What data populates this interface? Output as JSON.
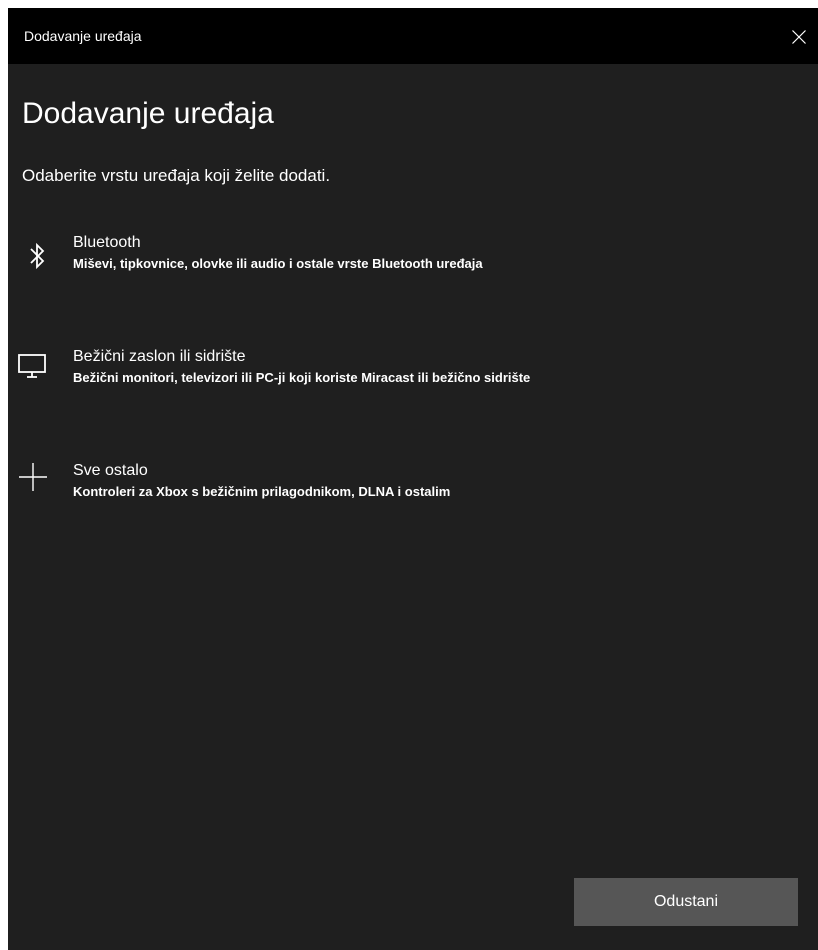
{
  "window": {
    "title": "Dodavanje uređaja"
  },
  "main": {
    "heading": "Dodavanje uređaja",
    "subtitle": "Odaberite vrstu uređaja koji želite dodati.",
    "options": [
      {
        "icon": "bluetooth-icon",
        "title": "Bluetooth",
        "description": "Miševi, tipkovnice, olovke ili audio i ostale vrste Bluetooth uređaja"
      },
      {
        "icon": "monitor-icon",
        "title": "Bežični zaslon ili sidrište",
        "description": "Bežični monitori, televizori ili PC-ji koji koriste Miracast ili bežično sidrište"
      },
      {
        "icon": "plus-icon",
        "title": "Sve ostalo",
        "description": "Kontroleri za Xbox s bežičnim prilagodnikom, DLNA i ostalim"
      }
    ]
  },
  "footer": {
    "cancel_label": "Odustani"
  },
  "colors": {
    "titlebar": "#000000",
    "background": "#1f1f1f",
    "text": "#ffffff",
    "button": "#565656"
  }
}
